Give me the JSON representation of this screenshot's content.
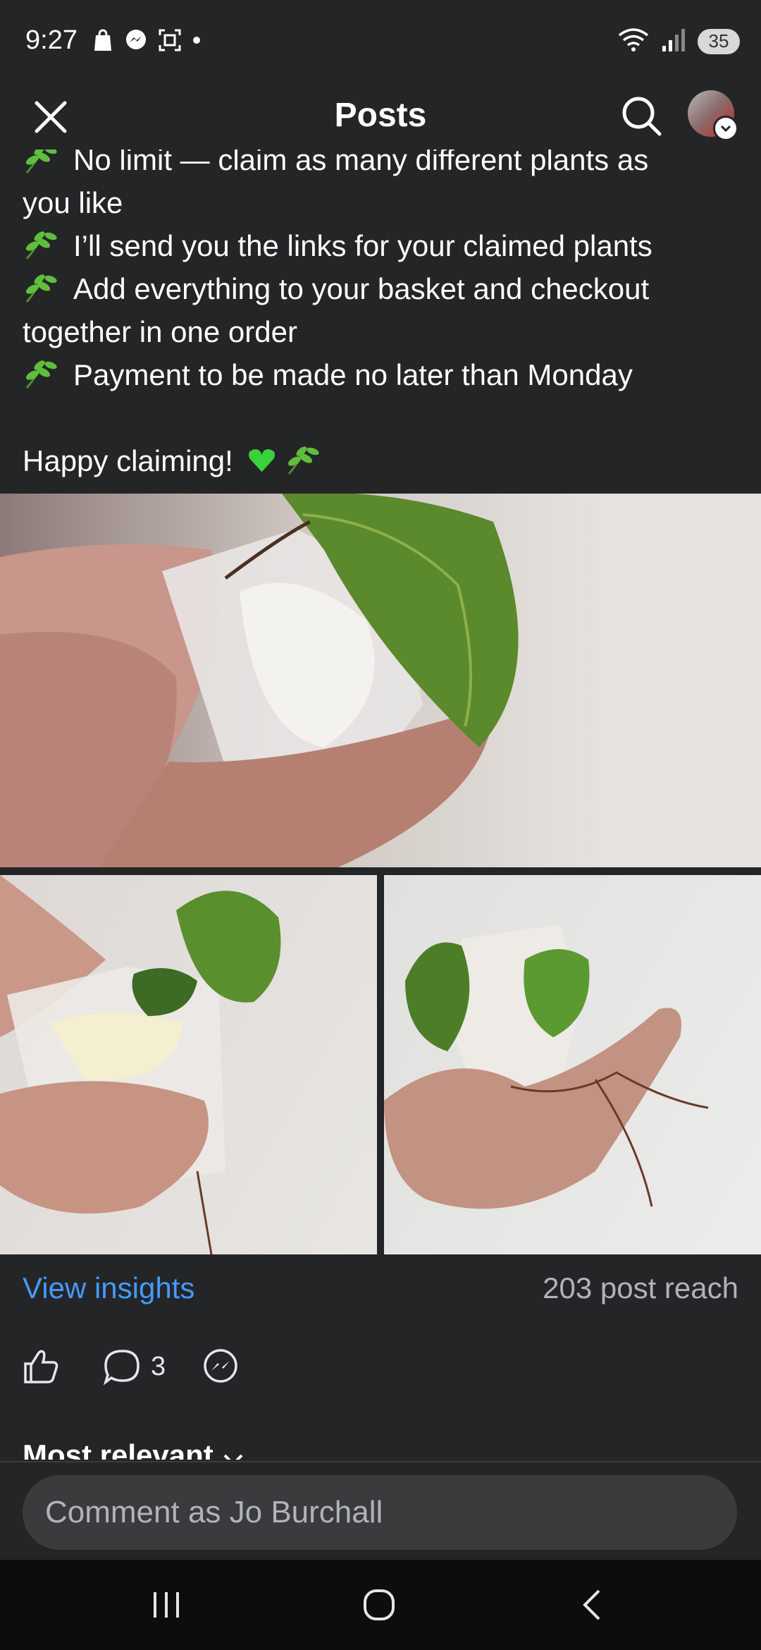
{
  "status_bar": {
    "time": "9:27",
    "battery": "35",
    "icons_left": [
      "shop-icon",
      "messenger-icon",
      "screenshot-icon",
      "dot-icon"
    ],
    "icons_right": [
      "wifi-icon",
      "signal-icon",
      "battery-icon"
    ]
  },
  "header": {
    "title": "Posts",
    "close_icon": "close-icon",
    "search_icon": "search-icon"
  },
  "post": {
    "lines": [
      "No limit — claim as many different plants as",
      "you like",
      "I’ll send you the links for your claimed plants",
      "Add everything to your basket and checkout",
      "together in one order",
      "Payment to be made no later than Monday",
      "",
      "Happy claiming!"
    ],
    "emoji_colors": {
      "leaf": "#5fbf3b",
      "heart": "#3bd13b"
    }
  },
  "stats": {
    "insights_label": "View insights",
    "reach": "203 post reach",
    "comment_count": "3"
  },
  "comments": {
    "sort_label": "Most relevant",
    "placeholder": "Comment as Jo Burchall"
  },
  "colors": {
    "background": "#242527",
    "link": "#4599ff",
    "secondary_text": "#b0b3b8"
  }
}
